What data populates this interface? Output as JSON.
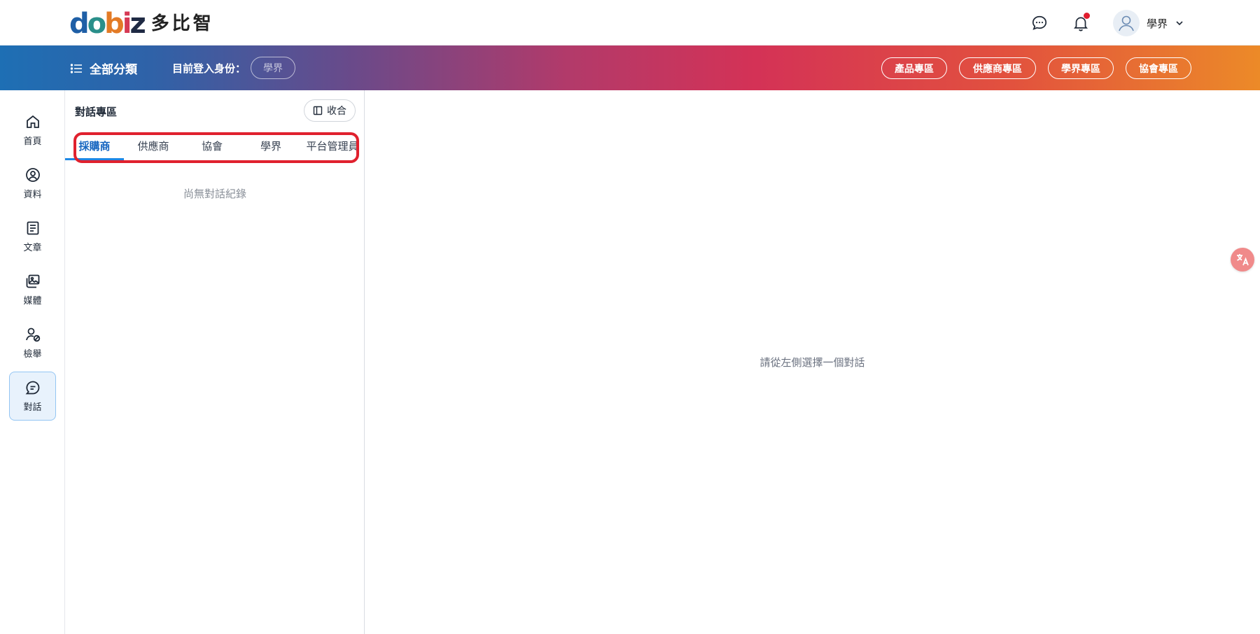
{
  "header": {
    "logo_mark": [
      "d",
      "o",
      "b",
      "i",
      "z"
    ],
    "logo_text": "多比智",
    "user_name": "學界",
    "icons": [
      "chat-bubble-icon",
      "bell-icon",
      "avatar-icon",
      "chevron-down-icon"
    ]
  },
  "band": {
    "all_categories": "全部分類",
    "role_label": "目前登入身份：",
    "role_value": "學界",
    "zones": [
      "產品專區",
      "供應商專區",
      "學界專區",
      "協會專區"
    ]
  },
  "sidenav": {
    "items": [
      {
        "label": "首頁",
        "icon": "home-icon"
      },
      {
        "label": "資料",
        "icon": "user-circle-icon"
      },
      {
        "label": "文章",
        "icon": "document-icon"
      },
      {
        "label": "媒體",
        "icon": "media-icon"
      },
      {
        "label": "檢舉",
        "icon": "user-block-icon"
      },
      {
        "label": "對話",
        "icon": "message-icon",
        "active": true
      }
    ]
  },
  "conversation": {
    "title": "對話專區",
    "collapse_label": "收合",
    "tabs": [
      "採購商",
      "供應商",
      "協會",
      "學界",
      "平台管理員"
    ],
    "active_tab": "採購商",
    "empty_text": "尚無對話紀錄"
  },
  "main": {
    "empty_text": "請從左側選擇一個對話"
  },
  "colors": {
    "accent": "#1565c0",
    "highlight": "#e0212e",
    "gradient": [
      "#1e6fb4",
      "#b23a6a",
      "#d43256",
      "#ec8a28"
    ]
  }
}
